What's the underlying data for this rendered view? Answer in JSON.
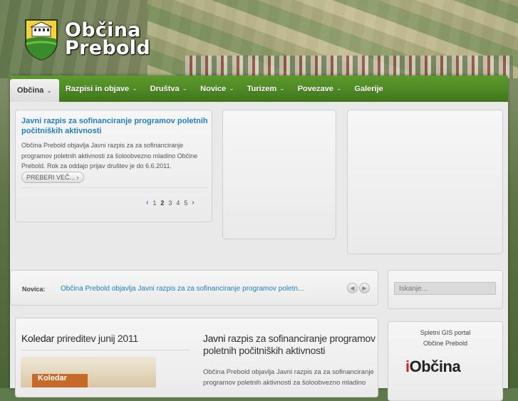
{
  "site": {
    "name_line1": "Občina",
    "name_line2": "Prebold"
  },
  "nav": {
    "items": [
      {
        "label": "Občina",
        "chevron": "⌄",
        "active": true
      },
      {
        "label": "Razpisi in objave",
        "chevron": "⌄"
      },
      {
        "label": "Društva",
        "chevron": "⌄"
      },
      {
        "label": "Novice",
        "chevron": "⌄"
      },
      {
        "label": "Turizem",
        "chevron": "⌄"
      },
      {
        "label": "Povezave",
        "chevron": "⌄"
      },
      {
        "label": "Galerije",
        "chevron": ""
      }
    ]
  },
  "slider": {
    "title": "Javni razpis za sofinanciranje programov poletnih počitniških aktivnosti",
    "text": "Občina Prebold objavlja Javni razpis za za sofinanciranje programov poletnih aktivnosti za šoloobvezno mladino Občine Prebold. Rok za oddajo prijav društev je do 6.6.2011.",
    "read_more": "PREBERI VEČ...",
    "read_more_arrow": "›",
    "pager": {
      "prev": "‹",
      "pages": [
        "1",
        "2",
        "3",
        "4",
        "5"
      ],
      "current": "2",
      "next": "›"
    }
  },
  "ticker": {
    "label": "Novica:",
    "text": "Občina Prebold objavlja Javni razpis za za sofinanciranje programov poletn...",
    "prev": "◀",
    "next": "▶"
  },
  "search": {
    "placeholder": "Iskanje..."
  },
  "calendar": {
    "title_strong": "Koledar",
    "title_rest": " prireditev junij 2011",
    "image_tag": "Koledar"
  },
  "article": {
    "title_strong": "Javni",
    "title_rest": " razpis za sofinanciranje programov poletnih počitniških aktivnosti",
    "text": "Občina Prebold objavlja Javni razpis za za sofinanciranje programov poletnih aktivnosti za šoloobvezno mladino"
  },
  "gis": {
    "line1": "Spletni GIS portal",
    "line2": "Občine Prebold",
    "logo_i": "i",
    "logo_text": "Občina"
  },
  "colors": {
    "nav_green": "#4f8a24",
    "link_blue": "#1f7fbf",
    "logo_red": "#d0202a"
  }
}
